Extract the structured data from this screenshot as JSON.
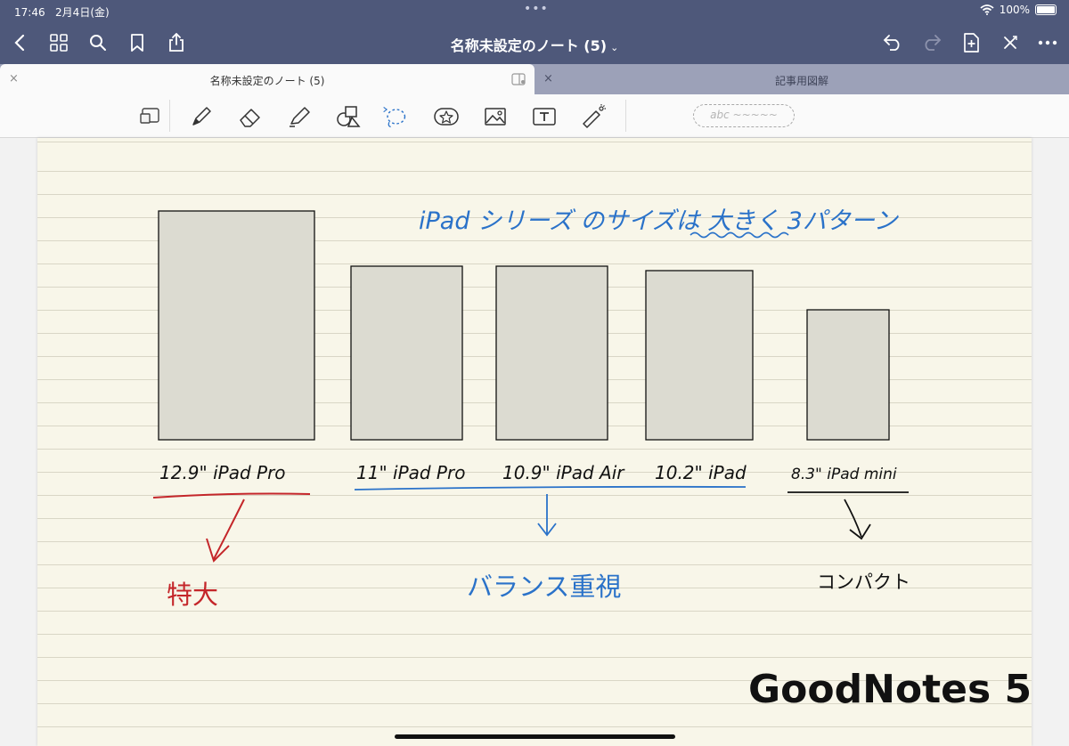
{
  "status_bar": {
    "time": "17:46",
    "date": "2月4日(金)",
    "battery": "100%",
    "dots": "•••"
  },
  "nav": {
    "title": "名称未設定のノート (5)",
    "chevron": "⌄",
    "icons": [
      "back-icon",
      "grid-icon",
      "search-icon",
      "bookmark-icon",
      "share-icon",
      "undo-icon",
      "redo-icon",
      "add-page-icon",
      "close-toolbar-icon",
      "more-icon"
    ]
  },
  "tabs": [
    {
      "label": "名称未設定のノート (5)",
      "close": "×",
      "active": true
    },
    {
      "label": "記事用図解",
      "close": "×",
      "active": false
    }
  ],
  "toolbar": {
    "tools": [
      "zoom-window-icon",
      "pen-icon",
      "eraser-icon",
      "highlighter-icon",
      "shapes-icon",
      "lasso-icon",
      "elements-icon",
      "image-icon",
      "text-box-icon",
      "laser-pointer-icon"
    ],
    "handwriting_placeholder": "abc ~~~~~"
  },
  "note": {
    "heading": "iPad シリーズ のサイズは 大きく 3パターン",
    "devices": [
      {
        "label": "12.9\" iPad Pro",
        "relative_height": 1.0
      },
      {
        "label": "11\" iPad Pro",
        "relative_height": 0.76
      },
      {
        "label": "10.9\" iPad Air",
        "relative_height": 0.76
      },
      {
        "label": "10.2\" iPad",
        "relative_height": 0.74
      },
      {
        "label": "8.3\" iPad mini",
        "relative_height": 0.57
      }
    ],
    "groups": [
      {
        "label": "特大",
        "color": "#c4262a"
      },
      {
        "label": "バランス重視",
        "color": "#2a72c9"
      },
      {
        "label": "コンパクト",
        "color": "#111111"
      }
    ],
    "footer": "GoodNotes 5"
  },
  "colors": {
    "header": "#4e587a",
    "paper": "#f8f6e9",
    "rect_fill": "#dcdbd1",
    "blue_ink": "#2a72c9",
    "red_ink": "#c4262a"
  }
}
